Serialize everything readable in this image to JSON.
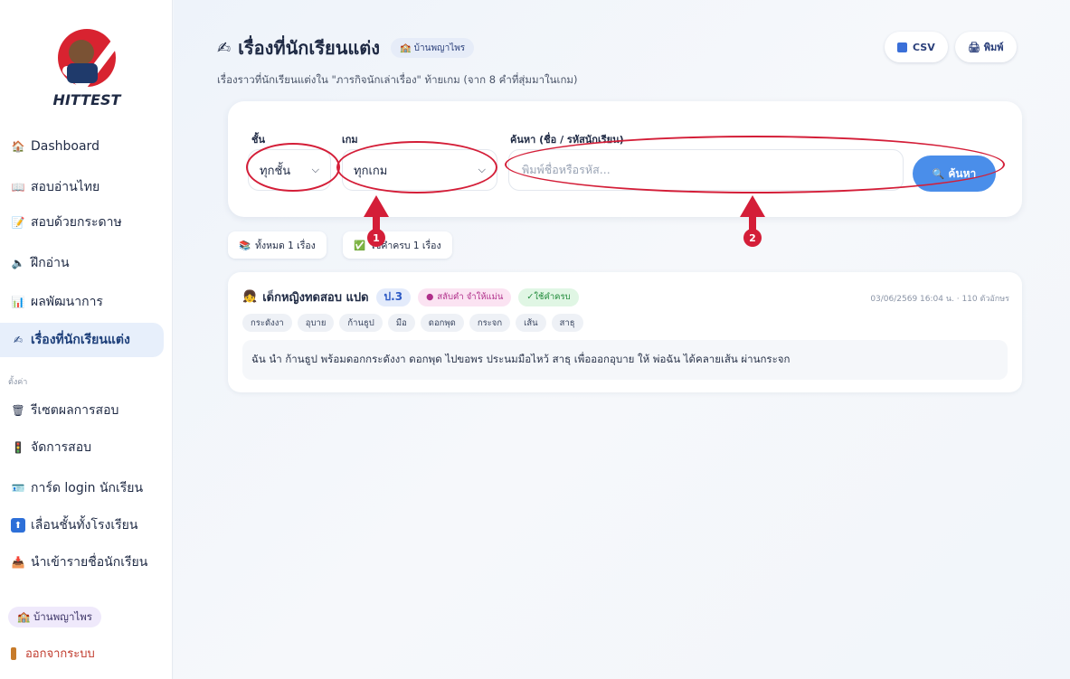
{
  "sidebar": {
    "logo_text": "HITTEST",
    "items": [
      {
        "label": "Dashboard",
        "icon": "house-icon"
      },
      {
        "label": "สอบอ่านไทย",
        "icon": "book-icon"
      },
      {
        "label": "สอบด้วยกระดาษ",
        "icon": "paper-icon"
      },
      {
        "label": "ฝึกอ่าน",
        "icon": "speaker-icon"
      },
      {
        "label": "ผลพัฒนาการ",
        "icon": "chart-icon"
      },
      {
        "label": "เรื่องที่นักเรียนแต่ง",
        "icon": "writing-hand-icon"
      }
    ],
    "section_label": "ตั้งค่า",
    "settings": [
      {
        "label": "รีเซตผลการสอบ",
        "icon": "trash-icon"
      },
      {
        "label": "จัดการสอบ",
        "icon": "traffic-light-icon"
      },
      {
        "label": "การ์ด login นักเรียน",
        "icon": "id-card-icon"
      },
      {
        "label": "เลื่อนชั้นทั้งโรงเรียน",
        "icon": "up-arrow-icon"
      },
      {
        "label": "นำเข้ารายชื่อนักเรียน",
        "icon": "upload-icon"
      }
    ],
    "school": "🏫 บ้านพญาไพร",
    "logout": "ออกจากระบบ"
  },
  "header": {
    "title": "เรื่องที่นักเรียนแต่ง",
    "badge": "🏫 บ้านพญาไพร",
    "subtitle": "เรื่องราวที่นักเรียนแต่งใน \"ภารกิจนักเล่าเรื่อง\" ท้ายเกม (จาก 8 คำที่สุ่มมาในเกม)",
    "csv_label": "CSV",
    "print_label": "🖨 พิมพ์"
  },
  "filters": {
    "grade_label": "ชั้น",
    "grade_value": "ทุกชั้น",
    "game_label": "เกม",
    "game_value": "ทุกเกม",
    "search_label": "ค้นหา (ชื่อ / รหัสนักเรียน)",
    "search_placeholder": "พิมพ์ชื่อหรือรหัส...",
    "search_button": "ค้นหา"
  },
  "summary": {
    "total": "ทั้งหมด 1 เรื่อง",
    "complete": "ใช้คำครบ 1 เรื่อง"
  },
  "stories": [
    {
      "student": "เด็กหญิงทดสอบ แปด",
      "grade": "ป.3",
      "tag_swap": "สลับคำ จำให้แม่น",
      "tag_ok": "✓ใช้คำครบ",
      "meta": "03/06/2569 16:04 น. · 110 ตัวอักษร",
      "words": [
        "กระดังงา",
        "อุบาย",
        "ก้านธูป",
        "มือ",
        "ดอกพุด",
        "กระจก",
        "เส้น",
        "สาธุ"
      ],
      "text": "ฉัน นำ ก้านธูป พร้อมดอกกระดังงา ดอกพุด ไปขอพร ประนมมือไหว้ สาธุ เพื่อออกอุบาย ให้ พ่อฉัน ได้คลายเส้น ผ่านกระจก"
    }
  ],
  "annotations": [
    "1",
    "2"
  ],
  "colors": {
    "accent": "#4a8eea",
    "annotation": "#d41e38",
    "active_bg": "#e7effb"
  }
}
